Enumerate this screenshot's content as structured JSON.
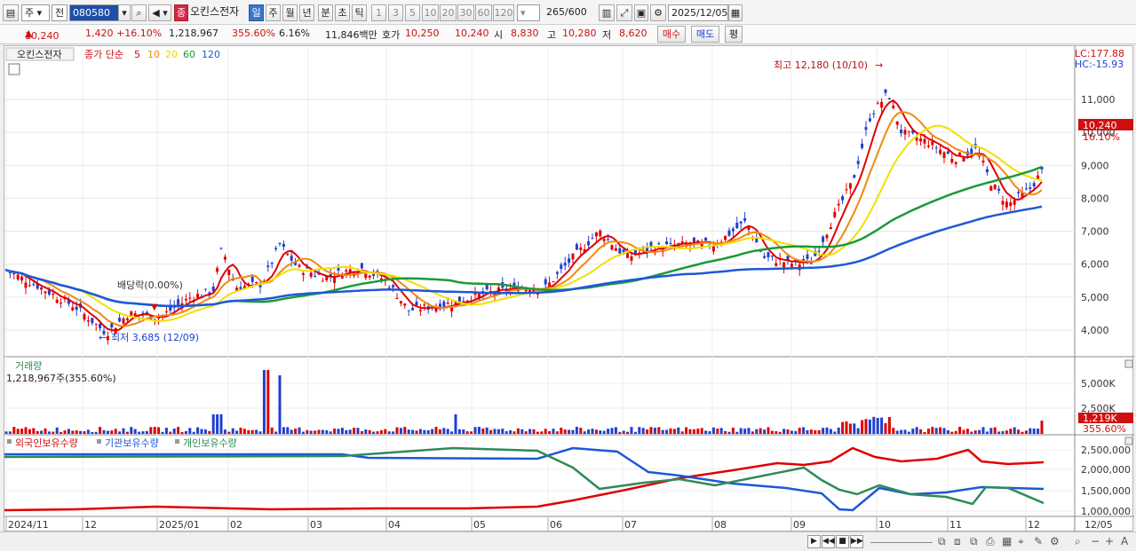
{
  "toolbar": {
    "type_label": "주",
    "type2_label": "전",
    "code": "080580",
    "stock_badge": "종",
    "stock_name": "오킨스전자",
    "periods": [
      "일",
      "주",
      "월",
      "년",
      "분",
      "초",
      "틱"
    ],
    "active_period": "일",
    "intervals": [
      "1",
      "3",
      "5",
      "10",
      "20",
      "30",
      "60",
      "120"
    ],
    "count_value": "265",
    "count_total": "/600",
    "date": "2025/12/05"
  },
  "quote": {
    "price": "10,240",
    "change": "1,420",
    "change_pct": "+16.10%",
    "volume": "1,218,967",
    "volume_ratio": "355.60%",
    "turnover": "6.16%",
    "amount": "11,846백만",
    "ask_label": "호가",
    "ask_values": "10,250",
    "bid_value": "10,240",
    "open_label": "시",
    "open": "8,830",
    "high_label": "고",
    "high": "10,280",
    "low_label": "저",
    "low": "8,620",
    "buy_label": "매수",
    "sell_label": "매도",
    "eval_label": "평"
  },
  "price_panel": {
    "stock_tag": "오킨스전자",
    "legend_prefix": "종가 단순",
    "legend_ma": [
      {
        "label": "5",
        "color": "#e00000"
      },
      {
        "label": "10",
        "color": "#f08a10"
      },
      {
        "label": "20",
        "color": "#e8d800"
      },
      {
        "label": "60",
        "color": "#1a9a3a"
      },
      {
        "label": "120",
        "color": "#1e58d8"
      }
    ],
    "lc": "LC:177.88",
    "hc": "HC:-15.93",
    "high_note": "최고 12,180 (10/10)",
    "low_note": "최저 3,685 (12/09)",
    "dividend_note": "배당락(0.00%)",
    "current_price": "10,240",
    "current_pct": "16.10%",
    "y_ticks": [
      "11,000",
      "10,000",
      "9,000",
      "8,000",
      "7,000",
      "6,000",
      "5,000",
      "4,000"
    ]
  },
  "volume_panel": {
    "title": "거래량",
    "value": "1,218,967주(355.60%)",
    "y_ticks": [
      "5,000K",
      "2,500K"
    ],
    "current_label": "1,219K",
    "current_pct": "355.60%"
  },
  "holding_panel": {
    "legend": [
      {
        "label": "외국인보유수량",
        "color": "#e00000"
      },
      {
        "label": "기관보유수량",
        "color": "#1e58d8"
      },
      {
        "label": "개인보유수량",
        "color": "#2e8b57"
      }
    ],
    "y_ticks": [
      "2,500,000",
      "2,000,000",
      "1,500,000",
      "1,000,000"
    ]
  },
  "x_axis": [
    "2024/11",
    "12",
    "2025/01",
    "02",
    "03",
    "04",
    "05",
    "06",
    "07",
    "08",
    "09",
    "10",
    "11",
    "12",
    "12/05"
  ]
}
